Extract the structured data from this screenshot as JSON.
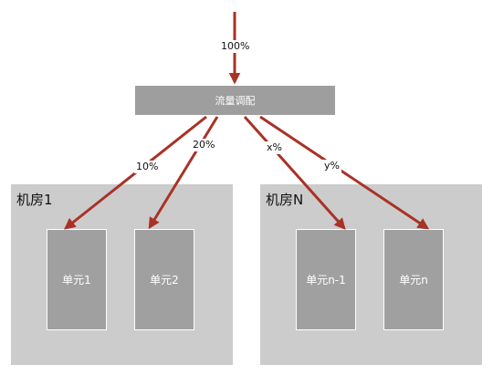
{
  "dispatcher": {
    "label": "流量调配"
  },
  "input_flow": {
    "percent_label": "100%"
  },
  "rooms": [
    {
      "title": "机房1",
      "units": [
        "单元1",
        "单元2"
      ]
    },
    {
      "title": "机房N",
      "units": [
        "单元n-1",
        "单元n"
      ]
    }
  ],
  "flows": [
    {
      "label": "10%",
      "target": "单元1"
    },
    {
      "label": "20%",
      "target": "单元2"
    },
    {
      "label": "x%",
      "target": "单元n-1"
    },
    {
      "label": "y%",
      "target": "单元n"
    }
  ],
  "colors": {
    "arrow": "#a93226",
    "room_bg": "#cccccc",
    "unit_bg": "#a0a0a0",
    "dispatcher_bg": "#9e9e9e"
  }
}
